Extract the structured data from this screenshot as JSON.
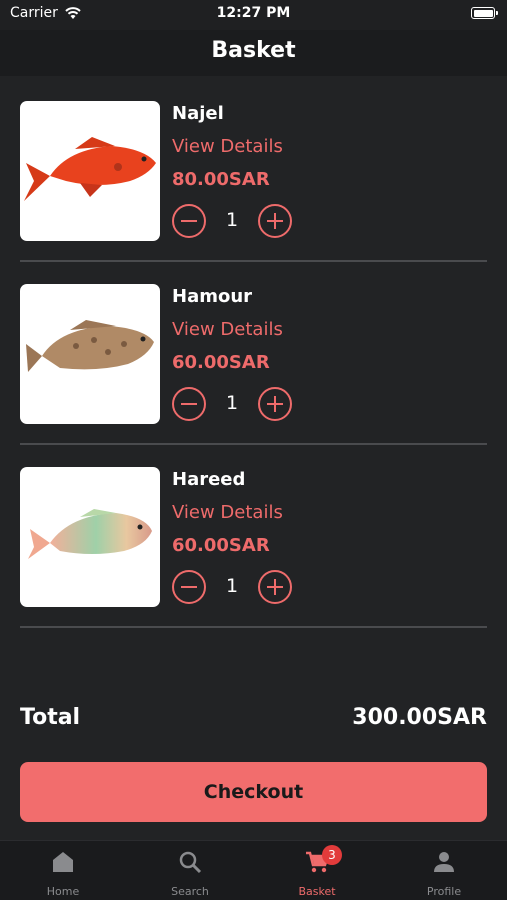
{
  "status_bar": {
    "carrier": "Carrier",
    "time": "12:27 PM"
  },
  "nav": {
    "title": "Basket"
  },
  "items": [
    {
      "name": "Najel",
      "link": "View Details",
      "price": "80.00SAR",
      "qty": "1"
    },
    {
      "name": "Hamour",
      "link": "View Details",
      "price": "60.00SAR",
      "qty": "1"
    },
    {
      "name": "Hareed",
      "link": "View Details",
      "price": "60.00SAR",
      "qty": "1"
    }
  ],
  "total": {
    "label": "Total",
    "value": "300.00SAR"
  },
  "checkout_label": "Checkout",
  "tabs": [
    {
      "label": "Home",
      "icon": "home-icon"
    },
    {
      "label": "Search",
      "icon": "search-icon"
    },
    {
      "label": "Basket",
      "icon": "cart-icon",
      "badge": "3"
    },
    {
      "label": "Profile",
      "icon": "profile-icon"
    }
  ],
  "colors": {
    "accent": "#ee6b6b",
    "button": "#f26d6d",
    "background": "#222325",
    "badge": "#e23b3b"
  }
}
